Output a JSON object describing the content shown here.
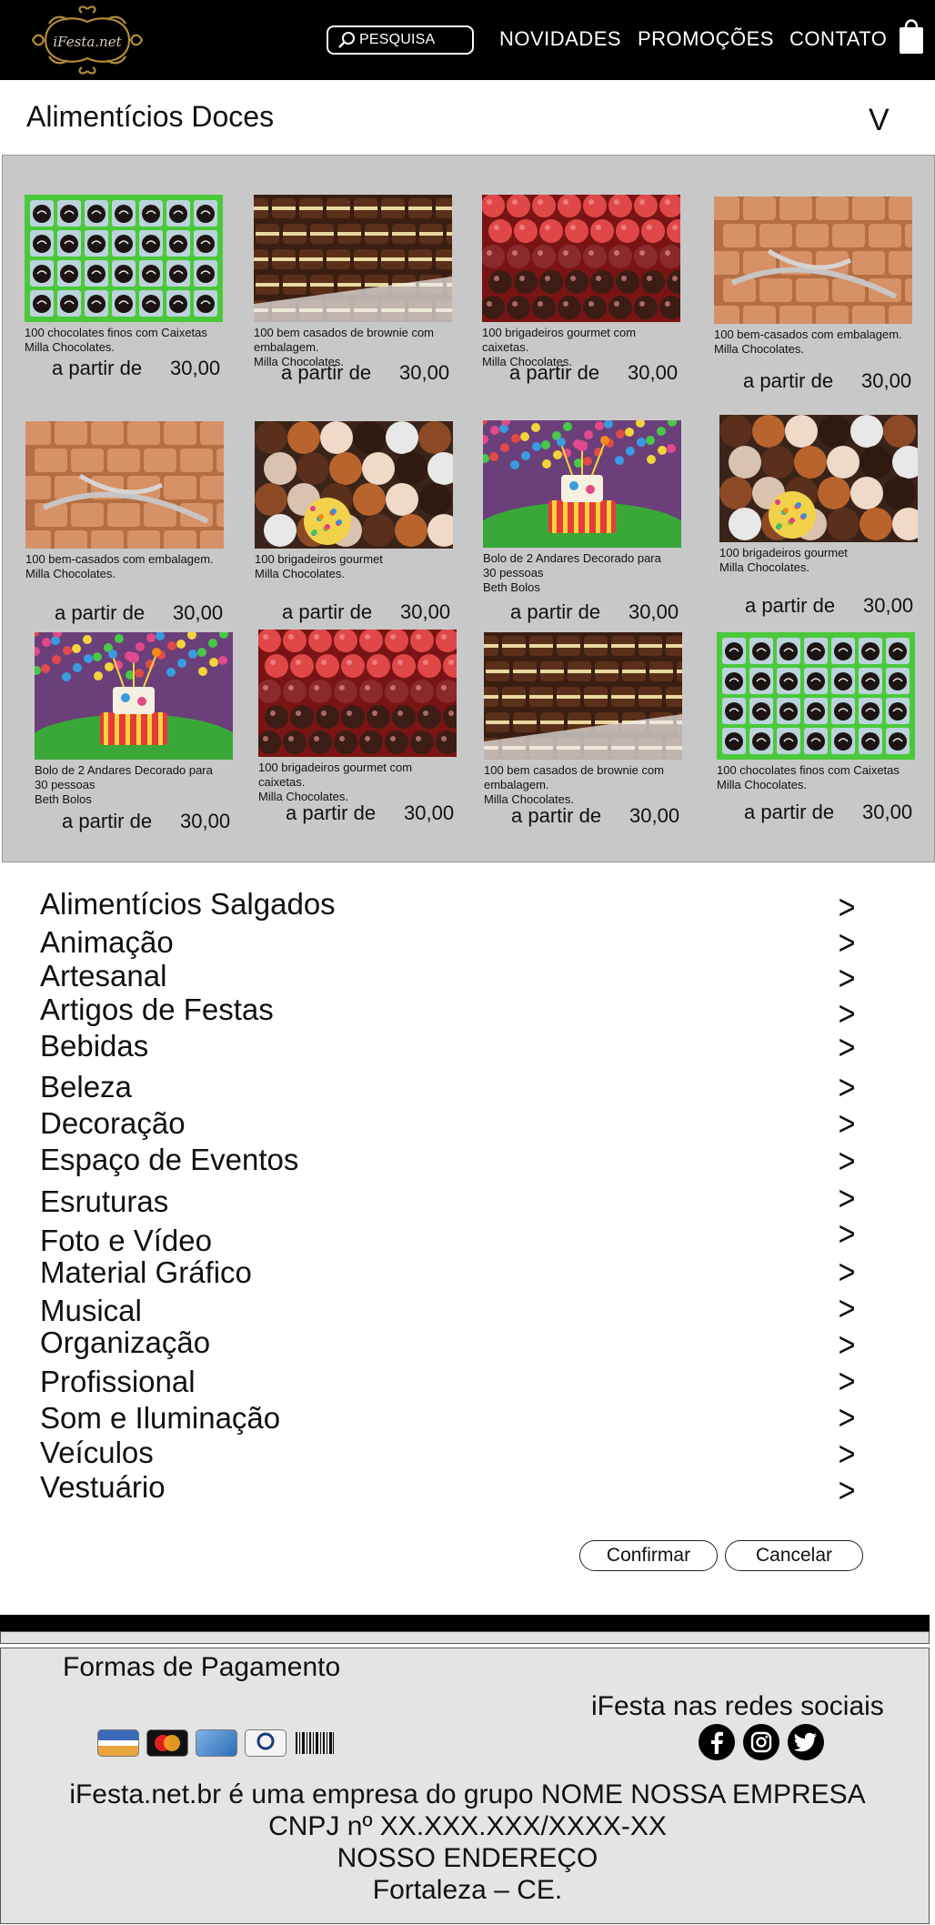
{
  "header": {
    "logo_text": "iFesta.net",
    "search_label": "PESQUISA",
    "nav": [
      "NOVIDADES",
      "PROMOÇÕES",
      "CONTATO"
    ]
  },
  "section": {
    "title": "Alimentícios Doces",
    "toggle": "V"
  },
  "products": [
    {
      "desc": "100 chocolates finos com Caixetas\nMilla Chocolates.",
      "price_label": "a partir de",
      "price": "30,00",
      "image": "chocolates-green"
    },
    {
      "desc": "100 bem casados de brownie com\nembalagem.\nMilla Chocolates.",
      "price_label": "a partir de",
      "price": "30,00",
      "image": "brownie"
    },
    {
      "desc": "100 brigadeiros gourmet com\ncaixetas.\nMilla Chocolates.",
      "price_label": "a partir de",
      "price": "30,00",
      "image": "brigadeiros-red"
    },
    {
      "desc": "100 bem-casados com embalagem.\nMilla Chocolates.",
      "price_label": "a partir de",
      "price": "30,00",
      "image": "bem-casados"
    },
    {
      "desc": "100 bem-casados com embalagem.\nMilla Chocolates.",
      "price_label": "a partir de",
      "price": "30,00",
      "image": "bem-casados"
    },
    {
      "desc": "100 brigadeiros gourmet\nMilla Chocolates.",
      "price_label": "a partir de",
      "price": "30,00",
      "image": "brigadeiros-mixed"
    },
    {
      "desc": "Bolo de 2 Andares Decorado para\n30 pessoas\nBeth Bolos",
      "price_label": "a partir de",
      "price": "30,00",
      "image": "cake"
    },
    {
      "desc": "100 brigadeiros gourmet\nMilla Chocolates.",
      "price_label": "a partir de",
      "price": "30,00",
      "image": "brigadeiros-mixed"
    },
    {
      "desc": "Bolo de 2 Andares Decorado para\n30 pessoas\nBeth Bolos",
      "price_label": "a partir de",
      "price": "30,00",
      "image": "cake"
    },
    {
      "desc": "100 brigadeiros gourmet com\ncaixetas.\nMilla Chocolates.",
      "price_label": "a partir de",
      "price": "30,00",
      "image": "brigadeiros-red"
    },
    {
      "desc": "100 bem casados de brownie com\nembalagem.\nMilla Chocolates.",
      "price_label": "a partir de",
      "price": "30,00",
      "image": "brownie"
    },
    {
      "desc": "100 chocolates finos com Caixetas\nMilla Chocolates.",
      "price_label": "a partir de",
      "price": "30,00",
      "image": "chocolates-green"
    }
  ],
  "categories": [
    {
      "label": "Alimentícios Salgados",
      "chevron": ">"
    },
    {
      "label": "Animação",
      "chevron": ">"
    },
    {
      "label": "Artesanal",
      "chevron": ">"
    },
    {
      "label": "Artigos de Festas",
      "chevron": ">"
    },
    {
      "label": "Bebidas",
      "chevron": ">"
    },
    {
      "label": "Beleza",
      "chevron": ">"
    },
    {
      "label": "Decoração",
      "chevron": ">"
    },
    {
      "label": "Espaço de Eventos",
      "chevron": ">"
    },
    {
      "label": "Esruturas",
      "chevron": ">"
    },
    {
      "label": "Foto e Vídeo",
      "chevron": ">"
    },
    {
      "label": "Material Gráfico",
      "chevron": ">"
    },
    {
      "label": "Musical",
      "chevron": ">"
    },
    {
      "label": "Organização",
      "chevron": ">"
    },
    {
      "label": "Profissional",
      "chevron": ">"
    },
    {
      "label": "Som e Iluminação",
      "chevron": ">"
    },
    {
      "label": "Veículos",
      "chevron": ">"
    },
    {
      "label": "Vestuário",
      "chevron": ">"
    }
  ],
  "actions": {
    "confirm": "Confirmar",
    "cancel": "Cancelar"
  },
  "footer": {
    "payment_title": "Formas de Pagamento",
    "payment_icons": [
      "visa-icon",
      "mastercard-icon",
      "american-express-icon",
      "diners-club-icon",
      "barcode-icon"
    ],
    "social_title": "iFesta nas redes sociais",
    "social_icons": [
      "facebook-icon",
      "instagram-icon",
      "twitter-icon"
    ],
    "company_line": "iFesta.net.br é uma empresa do grupo NOME NOSSA EMPRESA",
    "cnpj_line": "CNPJ nº XX.XXX.XXX/XXXX-XX",
    "address_line": "NOSSO ENDEREÇO",
    "city_line": "Fortaleza – CE."
  }
}
